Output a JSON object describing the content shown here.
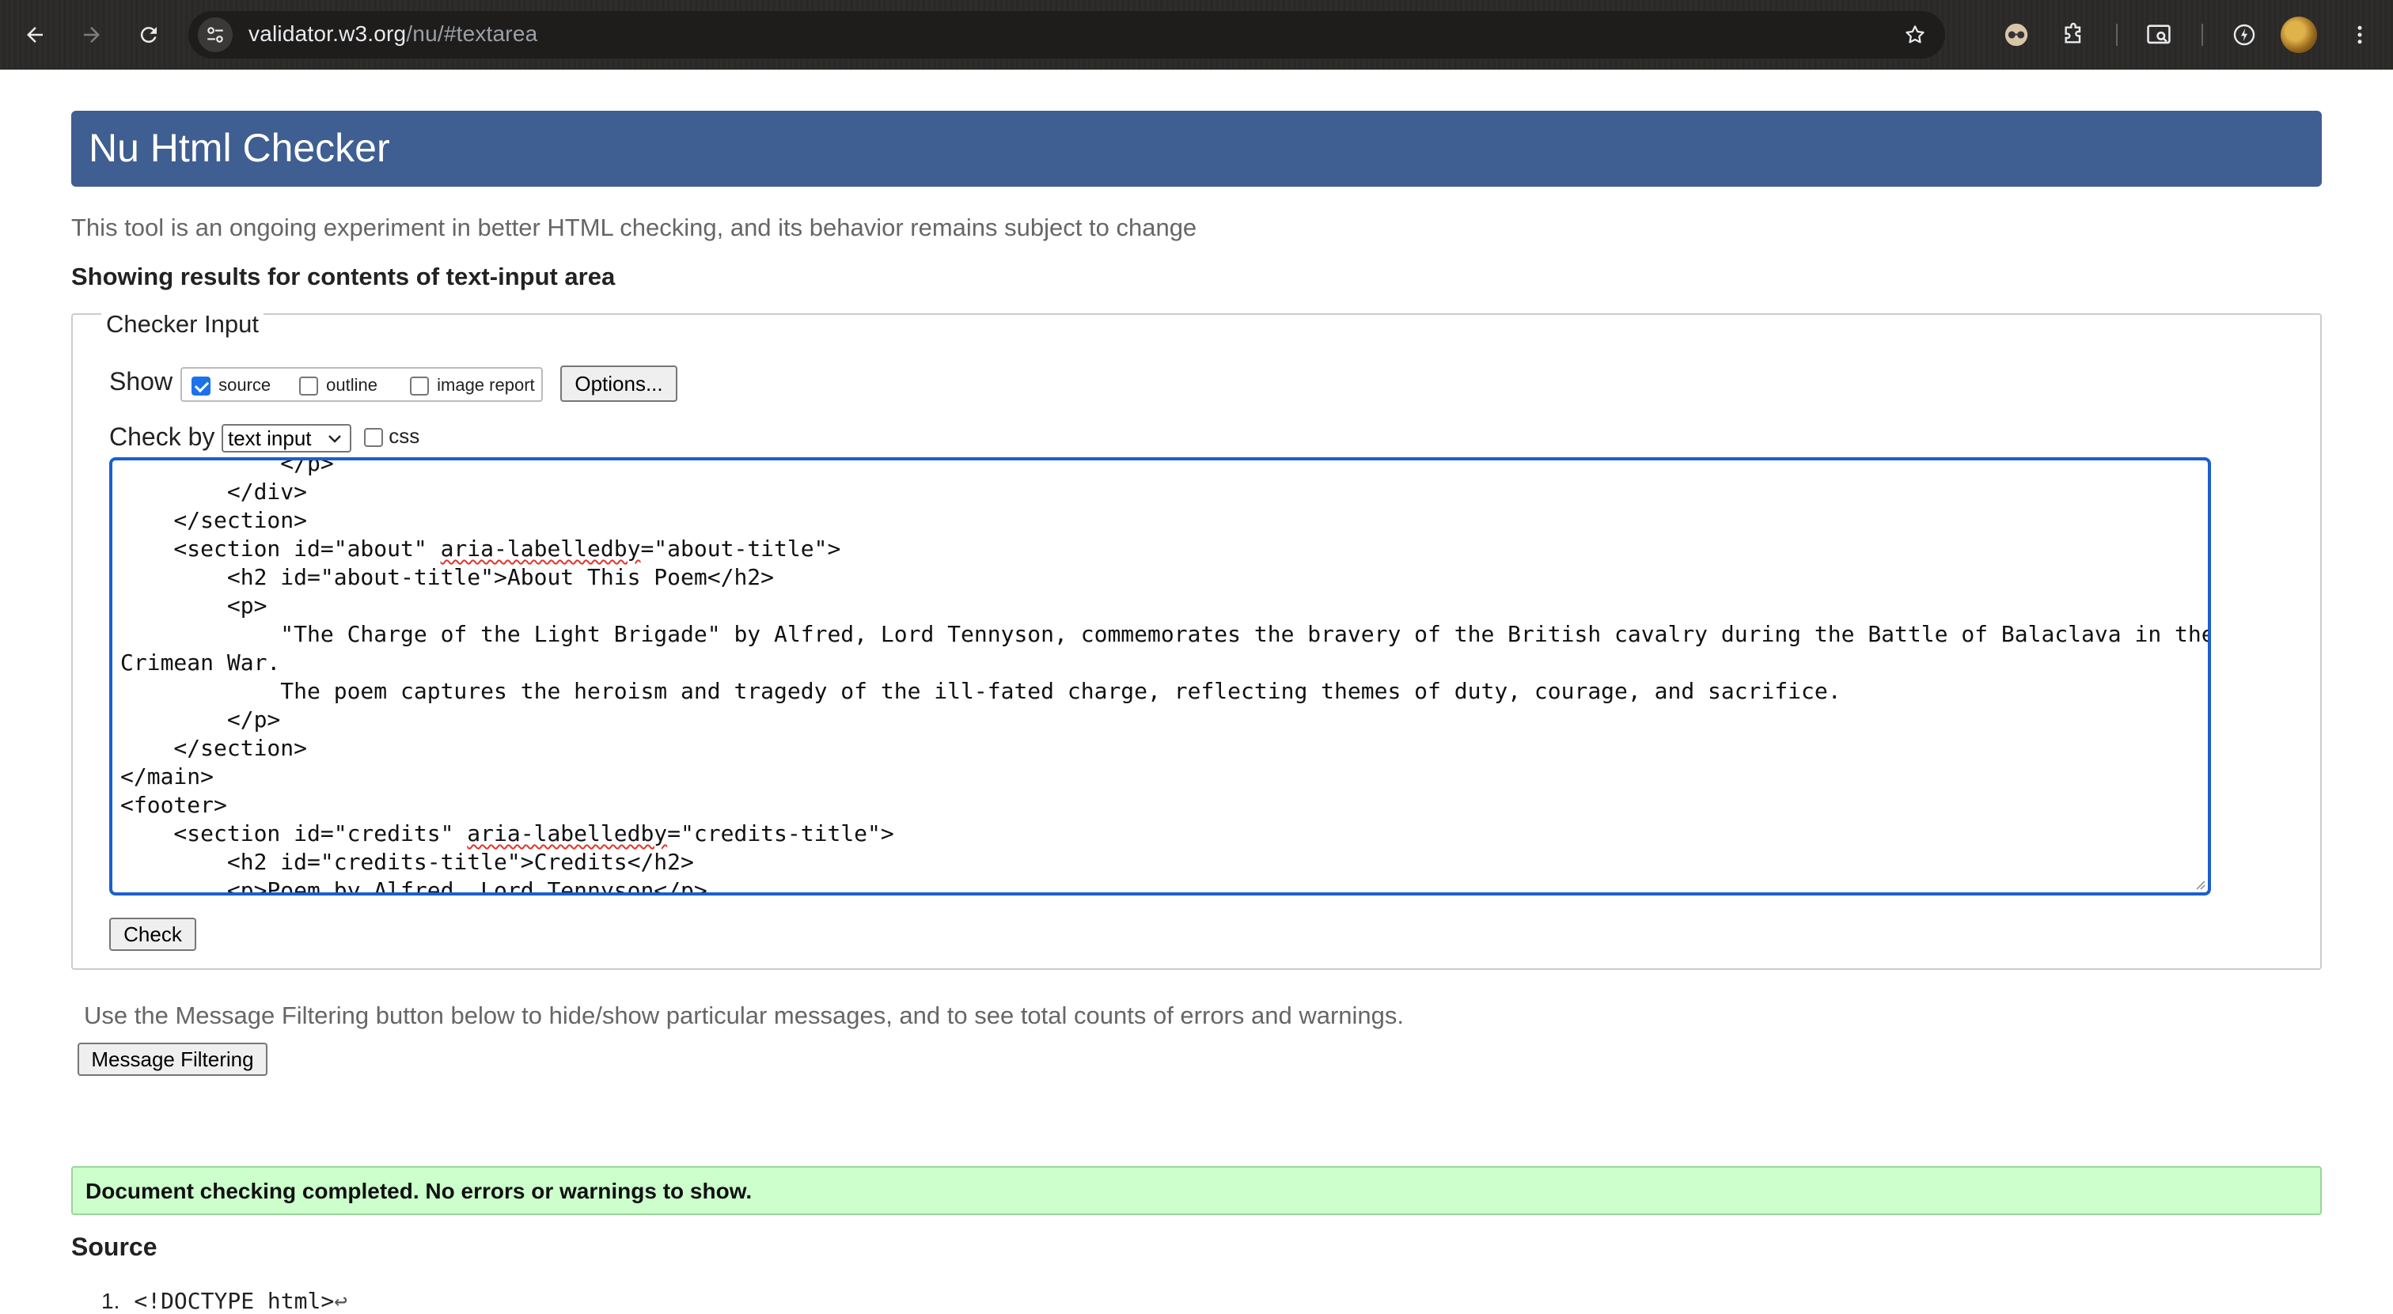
{
  "browser": {
    "url_host": "validator.w3.org",
    "url_path": "/nu/#textarea"
  },
  "page": {
    "title": "Nu Html Checker",
    "subtitle": "This tool is an ongoing experiment in better HTML checking, and its behavior remains subject to change",
    "showing": "Showing results for contents of text-input area"
  },
  "checker_input": {
    "legend": "Checker Input",
    "show_label": "Show",
    "show_options": [
      {
        "label": "source",
        "checked": true
      },
      {
        "label": "outline",
        "checked": false
      },
      {
        "label": "image report",
        "checked": false
      }
    ],
    "options_button": "Options...",
    "check_by_label": "Check by",
    "check_by_value": "text input",
    "css_label": "css",
    "css_checked": false,
    "check_button": "Check",
    "textarea_lines": [
      "            </p>",
      "        </div>",
      "    </section>",
      "    <section id=\"about\" aria-labelledby=\"about-title\">",
      "        <h2 id=\"about-title\">About This Poem</h2>",
      "        <p>",
      "            \"The Charge of the Light Brigade\" by Alfred, Lord Tennyson, commemorates the bravery of the British cavalry during the Battle of Balaclava in the",
      "Crimean War.",
      "            The poem captures the heroism and tragedy of the ill-fated charge, reflecting themes of duty, courage, and sacrifice.",
      "        </p>",
      "    </section>",
      "</main>",
      "<footer>",
      "    <section id=\"credits\" aria-labelledby=\"credits-title\">",
      "        <h2 id=\"credits-title\">Credits</h2>",
      "        <p>Poem by Alfred, Lord Tennyson</p>"
    ]
  },
  "filtering": {
    "note": "Use the Message Filtering button below to hide/show particular messages, and to see total counts of errors and warnings.",
    "button": "Message Filtering"
  },
  "result": {
    "message": "Document checking completed. No errors or warnings to show."
  },
  "source": {
    "heading": "Source",
    "first_line_number": "1.",
    "first_line_text": "<!DOCTYPE html>",
    "first_line_return": "↩"
  },
  "icons": [
    "back-icon",
    "forward-icon",
    "reload-icon",
    "site-settings-icon",
    "bookmark-star-icon",
    "extension-glasses-icon",
    "extensions-puzzle-icon",
    "tab-search-icon",
    "performance-icon",
    "profile-avatar",
    "menu-kebab-icon",
    "chevron-down-icon"
  ]
}
